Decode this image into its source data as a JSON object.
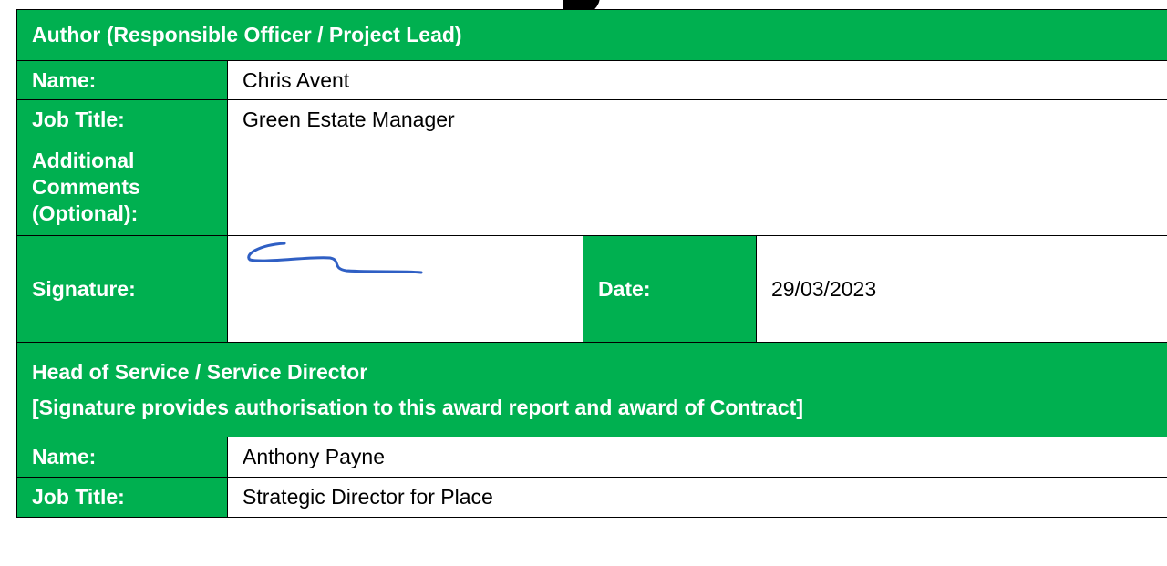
{
  "author_section": {
    "heading": "Author (Responsible Officer / Project Lead)",
    "name_label": "Name:",
    "name_value": "Chris Avent",
    "job_title_label": "Job Title:",
    "job_title_value": "Green Estate Manager",
    "comments_label_1": "Additional",
    "comments_label_2": "Comments",
    "comments_label_3": "(Optional):",
    "comments_value": "",
    "signature_label": "Signature:",
    "date_label": "Date:",
    "date_value": "29/03/2023"
  },
  "head_of_service_section": {
    "heading_line1": "Head of Service / Service Director",
    "heading_line2": "[Signature provides authorisation to this award report and award of Contract]",
    "name_label": "Name:",
    "name_value": "Anthony Payne",
    "job_title_label": "Job Title:",
    "job_title_value": "Strategic Director for Place"
  },
  "colors": {
    "label_green": "#00b050",
    "signature_ink": "#2f5fc4"
  }
}
